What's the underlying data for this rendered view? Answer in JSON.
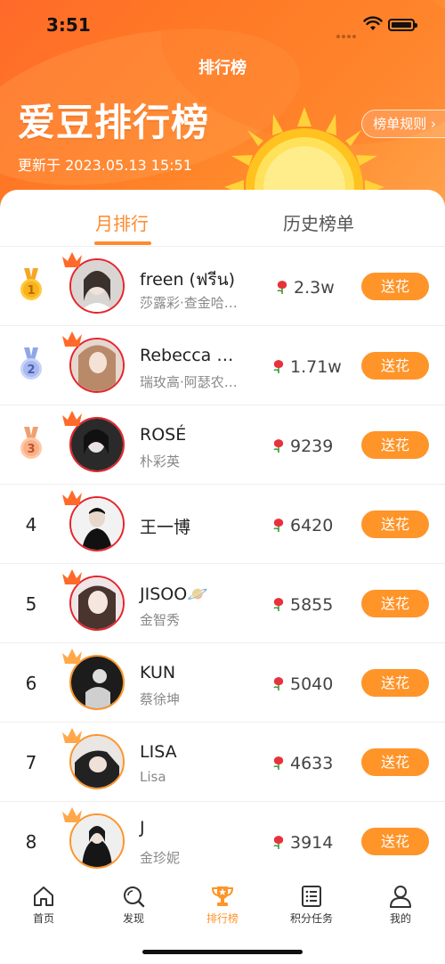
{
  "status": {
    "time": "3:51"
  },
  "header": {
    "nav_title": "排行榜",
    "big_title": "爱豆排行榜",
    "update_text": "更新于 2023.05.13 15:51",
    "rules_label": "榜单规则",
    "rules_icon": "chevron-right-icon"
  },
  "tabs": [
    {
      "label": "月排行",
      "active": true
    },
    {
      "label": "历史榜单",
      "active": false
    }
  ],
  "ranking": [
    {
      "rank": "1",
      "name": "freen (ฟรีน)",
      "alias": "莎露彩·查金哈…",
      "score": "2.3w",
      "button": "送花"
    },
    {
      "rank": "2",
      "name": "Rebecca …",
      "alias": "瑞玫高·阿瑟农…",
      "score": "1.71w",
      "button": "送花"
    },
    {
      "rank": "3",
      "name": "ROSÉ",
      "alias": "朴彩英",
      "score": "9239",
      "button": "送花"
    },
    {
      "rank": "4",
      "name": "王一博",
      "alias": "",
      "score": "6420",
      "button": "送花"
    },
    {
      "rank": "5",
      "name": "JISOO🪐",
      "alias": "金智秀",
      "score": "5855",
      "button": "送花"
    },
    {
      "rank": "6",
      "name": "KUN",
      "alias": "蔡徐坤",
      "score": "5040",
      "button": "送花"
    },
    {
      "rank": "7",
      "name": "LISA",
      "alias": "Lisa",
      "score": "4633",
      "button": "送花"
    },
    {
      "rank": "8",
      "name": "J",
      "alias": "金珍妮",
      "score": "3914",
      "button": "送花"
    }
  ],
  "tabbar": [
    {
      "label": "首页",
      "icon": "home-icon",
      "active": false
    },
    {
      "label": "发现",
      "icon": "discover-icon",
      "active": false
    },
    {
      "label": "排行榜",
      "icon": "trophy-icon",
      "active": true
    },
    {
      "label": "积分任务",
      "icon": "task-list-icon",
      "active": false
    },
    {
      "label": "我的",
      "icon": "profile-icon",
      "active": false
    }
  ],
  "colors": {
    "accent": "#ff9429",
    "header_gradient_start": "#ff6a2a",
    "header_gradient_end": "#ffa14a",
    "avatar_border_top": "#e6242b",
    "avatar_border": "#ff9429"
  }
}
